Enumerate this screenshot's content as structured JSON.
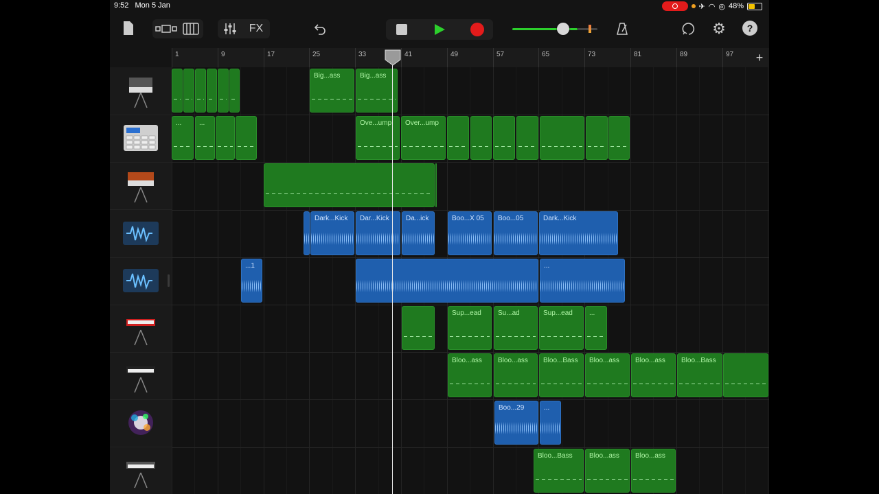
{
  "status": {
    "time": "9:52",
    "date": "Mon 5 Jan",
    "battery": "48%"
  },
  "toolbar": {
    "fx_label": "FX"
  },
  "ruler": {
    "bars": [
      "1",
      "9",
      "17",
      "25",
      "33",
      "41",
      "49",
      "57",
      "65",
      "73",
      "81",
      "89",
      "97"
    ]
  },
  "colors": {
    "midi": "#1f7a1f",
    "audio": "#1f5fae",
    "record": "#e31b1b",
    "play": "#2ccf2c"
  },
  "tracks": [
    {
      "icon": "synth-keyboard-icon",
      "regions": [
        {
          "label": "",
          "kind": "midi"
        },
        {
          "label": "",
          "kind": "midi"
        },
        {
          "label": "",
          "kind": "midi"
        },
        {
          "label": "",
          "kind": "midi"
        },
        {
          "label": "",
          "kind": "midi"
        },
        {
          "label": "",
          "kind": "midi"
        },
        {
          "label": "Big...ass",
          "kind": "midi"
        },
        {
          "label": "Big...ass",
          "kind": "midi"
        }
      ]
    },
    {
      "icon": "drum-machine-icon",
      "regions": [
        {
          "label": "...",
          "kind": "midi"
        },
        {
          "label": "...",
          "kind": "midi"
        },
        {
          "label": "",
          "kind": "midi"
        },
        {
          "label": "",
          "kind": "midi"
        },
        {
          "label": "Ove...ump",
          "kind": "midi"
        },
        {
          "label": "Over...ump",
          "kind": "midi"
        },
        {
          "label": "",
          "kind": "midi"
        },
        {
          "label": "",
          "kind": "midi"
        },
        {
          "label": "",
          "kind": "midi"
        },
        {
          "label": "",
          "kind": "midi"
        },
        {
          "label": "",
          "kind": "midi"
        },
        {
          "label": "",
          "kind": "midi"
        },
        {
          "label": "",
          "kind": "midi"
        }
      ]
    },
    {
      "icon": "analog-synth-icon",
      "regions": [
        {
          "label": "",
          "kind": "midi"
        },
        {
          "label": "",
          "kind": "midi"
        }
      ]
    },
    {
      "icon": "audio-waveform-icon",
      "regions": [
        {
          "label": "",
          "kind": "audio"
        },
        {
          "label": "Dark...Kick",
          "kind": "audio"
        },
        {
          "label": "Dar...Kick",
          "kind": "audio"
        },
        {
          "label": "Da...ick",
          "kind": "audio"
        },
        {
          "label": "Boo...X 05",
          "kind": "audio"
        },
        {
          "label": "Boo...05",
          "kind": "audio"
        },
        {
          "label": "Dark...Kick",
          "kind": "audio"
        }
      ]
    },
    {
      "icon": "audio-waveform-icon",
      "regions": [
        {
          "label": "...1",
          "kind": "audio"
        },
        {
          "label": "",
          "kind": "audio"
        },
        {
          "label": "...",
          "kind": "audio"
        }
      ]
    },
    {
      "icon": "red-keyboard-icon",
      "regions": [
        {
          "label": "",
          "kind": "midi"
        },
        {
          "label": "Sup...ead",
          "kind": "midi"
        },
        {
          "label": "Su...ad",
          "kind": "midi"
        },
        {
          "label": "Sup...ead",
          "kind": "midi"
        },
        {
          "label": "...",
          "kind": "midi"
        }
      ]
    },
    {
      "icon": "black-keyboard-icon",
      "regions": [
        {
          "label": "Bloo...ass",
          "kind": "midi"
        },
        {
          "label": "Bloo...ass",
          "kind": "midi"
        },
        {
          "label": "Bloo...Bass",
          "kind": "midi"
        },
        {
          "label": "Bloo...ass",
          "kind": "midi"
        },
        {
          "label": "Bloo...ass",
          "kind": "midi"
        },
        {
          "label": "Bloo...Bass",
          "kind": "midi"
        },
        {
          "label": "",
          "kind": "midi"
        }
      ]
    },
    {
      "icon": "sparkle-instrument-icon",
      "regions": [
        {
          "label": "Boo...29",
          "kind": "audio"
        },
        {
          "label": "...",
          "kind": "audio"
        }
      ]
    },
    {
      "icon": "keyboard-stand-icon",
      "regions": [
        {
          "label": "Bloo...Bass",
          "kind": "midi"
        },
        {
          "label": "Bloo...ass",
          "kind": "midi"
        },
        {
          "label": "Bloo...ass",
          "kind": "midi"
        }
      ]
    }
  ]
}
